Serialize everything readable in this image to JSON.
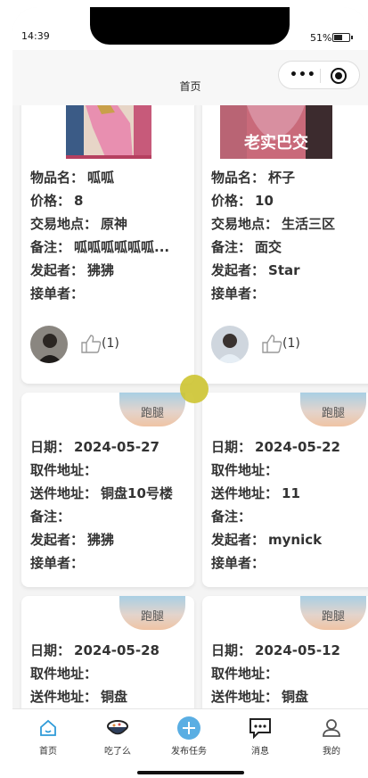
{
  "status": {
    "time": "14:39",
    "battery": "51%"
  },
  "nav": {
    "title": "首页"
  },
  "labels": {
    "item_name": "物品名：",
    "price": "价格：",
    "place": "交易地点：",
    "note": "备注：",
    "initiator": "发起者：",
    "taker": "接单者：",
    "date": "日期：",
    "pickup": "取件地址：",
    "delivery": "送件地址："
  },
  "trade_cards": [
    {
      "image": "pink-figure-image",
      "item_name": "呱呱",
      "price": "8",
      "place": "原神",
      "note": "呱呱呱呱呱呱...",
      "initiator": "狒狒",
      "taker": "",
      "likes": "(1)"
    },
    {
      "image": "老实巴交",
      "item_name": "杯子",
      "price": "10",
      "place": "生活三区",
      "note": "面交",
      "initiator": "Star",
      "taker": "",
      "likes": "(1)"
    }
  ],
  "errand_cards": [
    {
      "badge": "跑腿",
      "date": "2024-05-27",
      "pickup": "",
      "delivery": "铜盘10号楼",
      "note": "",
      "initiator": "狒狒",
      "taker": ""
    },
    {
      "badge": "跑腿",
      "date": "2024-05-22",
      "pickup": "",
      "delivery": "11",
      "note": "",
      "initiator": "mynick",
      "taker": ""
    },
    {
      "badge": "跑腿",
      "date": "2024-05-28",
      "pickup": "",
      "delivery": "铜盘",
      "note": ""
    },
    {
      "badge": "跑腿",
      "date": "2024-05-12",
      "pickup": "",
      "delivery": "铜盘"
    }
  ],
  "tabs": [
    {
      "label": "首页",
      "icon": "home-icon"
    },
    {
      "label": "吃了么",
      "icon": "food-bowl-icon"
    },
    {
      "label": "发布任务",
      "icon": "plus-circle-icon"
    },
    {
      "label": "消息",
      "icon": "chat-icon"
    },
    {
      "label": "我的",
      "icon": "user-icon"
    }
  ],
  "colors": {
    "accent": "#2f9bd8",
    "badge_top": "#a9cfe4",
    "badge_bottom": "#efc4a4"
  }
}
